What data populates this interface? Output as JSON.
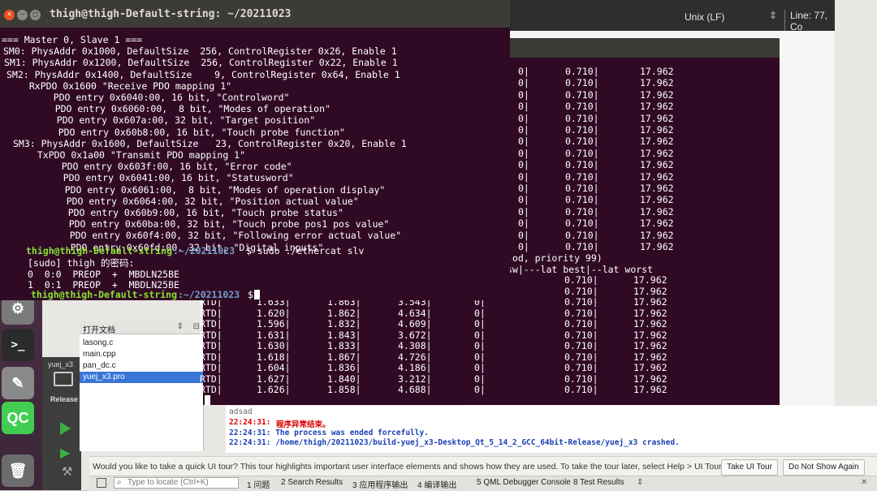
{
  "qtcreator": {
    "encoding": "Unix (LF)",
    "line_info": "Line: 77, Co",
    "kit_label": "yuej_x3",
    "build_config": "Release",
    "open_docs": {
      "title": "打开文档",
      "items": [
        "lasong.c",
        "main.cpp",
        "pan_dc.c",
        "yuej_x3.pro"
      ],
      "selected": 3
    },
    "app_output": {
      "line1": "adsad",
      "line2_time": "22:24:31:",
      "line2_msg": "程序异常结束。",
      "line3": "22:24:31: The process was ended forcefully.",
      "line4": "22:24:31: /home/thigh/20211023/build-yuej_x3-Desktop_Qt_5_14_2_GCC_64bit-Release/yuej_x3 crashed."
    },
    "tour": {
      "text": "Would you like to take a quick UI tour? This tour highlights important user interface elements and shows how they are used. To take the tour later, select Help > UI Tour.",
      "take_label": "Take UI Tour",
      "dismiss_label": "Do Not Show Again"
    },
    "statusbar": {
      "locator_placeholder": "Type to locate (Ctrl+K)",
      "tabs": [
        "1 问题",
        "2 Search Results",
        "3 应用程序输出",
        "4 编译输出",
        "5 QML Debugger Console",
        "8 Test Results"
      ]
    }
  },
  "terminal_back": {
    "top_rows": [
      {
        "a": "0|",
        "b": "0.710|",
        "c": "17.962"
      },
      {
        "a": "0|",
        "b": "0.710|",
        "c": "17.962"
      },
      {
        "a": "0|",
        "b": "0.710|",
        "c": "17.962"
      },
      {
        "a": "0|",
        "b": "0.710|",
        "c": "17.962"
      },
      {
        "a": "0|",
        "b": "0.710|",
        "c": "17.962"
      },
      {
        "a": "0|",
        "b": "0.710|",
        "c": "17.962"
      },
      {
        "a": "0|",
        "b": "0.710|",
        "c": "17.962"
      },
      {
        "a": "0|",
        "b": "0.710|",
        "c": "17.962"
      },
      {
        "a": "0|",
        "b": "0.710|",
        "c": "17.962"
      },
      {
        "a": "0|",
        "b": "0.710|",
        "c": "17.962"
      },
      {
        "a": "0|",
        "b": "0.710|",
        "c": "17.962"
      },
      {
        "a": "0|",
        "b": "0.710|",
        "c": "17.962"
      },
      {
        "a": "0|",
        "b": "0.710|",
        "c": "17.962"
      },
      {
        "a": "0|",
        "b": "0.710|",
        "c": "17.962"
      },
      {
        "a": "0|",
        "b": "0.710|",
        "c": "17.962"
      },
      {
        "a": "0|",
        "b": "0.710|",
        "c": "17.962"
      }
    ],
    "priority_line": ".od, priority 99)",
    "header_line": "sw|---lat best|--lat worst",
    "bottom_rows": [
      {
        "rtd": "",
        "a": "",
        "b": "",
        "c": "",
        "d": "0|",
        "e": "0.710|",
        "f": "17.962"
      },
      {
        "rtd": "",
        "a": "",
        "b": "",
        "c": "",
        "d": "0|",
        "e": "0.710|",
        "f": "17.962"
      },
      {
        "rtd": "RTD|",
        "a": "1.633|",
        "b": "1.863|",
        "c": "3.543|",
        "d": "0|",
        "e": "0.710|",
        "f": "17.962"
      },
      {
        "rtd": "RTD|",
        "a": "1.620|",
        "b": "1.862|",
        "c": "4.634|",
        "d": "0|",
        "e": "0.710|",
        "f": "17.962"
      },
      {
        "rtd": "RTD|",
        "a": "1.596|",
        "b": "1.832|",
        "c": "4.609|",
        "d": "0|",
        "e": "0.710|",
        "f": "17.962"
      },
      {
        "rtd": "RTD|",
        "a": "1.631|",
        "b": "1.843|",
        "c": "3.672|",
        "d": "0|",
        "e": "0.710|",
        "f": "17.962"
      },
      {
        "rtd": "RTD|",
        "a": "1.630|",
        "b": "1.833|",
        "c": "4.308|",
        "d": "0|",
        "e": "0.710|",
        "f": "17.962"
      },
      {
        "rtd": "RTD|",
        "a": "1.618|",
        "b": "1.867|",
        "c": "4.726|",
        "d": "0|",
        "e": "0.710|",
        "f": "17.962"
      },
      {
        "rtd": "RTD|",
        "a": "1.604|",
        "b": "1.836|",
        "c": "4.186|",
        "d": "0|",
        "e": "0.710|",
        "f": "17.962"
      },
      {
        "rtd": "RTD|",
        "a": "1.627|",
        "b": "1.840|",
        "c": "3.212|",
        "d": "0|",
        "e": "0.710|",
        "f": "17.962"
      },
      {
        "rtd": "RTD|",
        "a": "1.626|",
        "b": "1.858|",
        "c": "4.688|",
        "d": "0|",
        "e": "0.710|",
        "f": "17.962"
      }
    ]
  },
  "terminal_front": {
    "title": "thigh@thigh-Default-string: ~/20211023",
    "lines": [
      "=== Master 0, Slave 1 ===",
      "SM0: PhysAddr 0x1000, DefaultSize  256, ControlRegister 0x26, Enable 1",
      "SM1: PhysAddr 0x1200, DefaultSize  256, ControlRegister 0x22, Enable 1",
      "SM2: PhysAddr 0x1400, DefaultSize    9, ControlRegister 0x64, Enable 1",
      "  RxPDO 0x1600 \"Receive PDO mapping 1\"",
      "    PDO entry 0x6040:00, 16 bit, \"Controlword\"",
      "    PDO entry 0x6060:00,  8 bit, \"Modes of operation\"",
      "    PDO entry 0x607a:00, 32 bit, \"Target position\"",
      "    PDO entry 0x60b8:00, 16 bit, \"Touch probe function\"",
      "SM3: PhysAddr 0x1600, DefaultSize   23, ControlRegister 0x20, Enable 1",
      "  TxPDO 0x1a00 \"Transmit PDO mapping 1\"",
      "    PDO entry 0x603f:00, 16 bit, \"Error code\"",
      "    PDO entry 0x6041:00, 16 bit, \"Statusword\"",
      "    PDO entry 0x6061:00,  8 bit, \"Modes of operation display\"",
      "    PDO entry 0x6064:00, 32 bit, \"Position actual value\"",
      "    PDO entry 0x60b9:00, 16 bit, \"Touch probe status\"",
      "    PDO entry 0x60ba:00, 32 bit, \"Touch probe pos1 pos value\"",
      "    PDO entry 0x60f4:00, 32 bit, \"Following error actual value\"",
      "    PDO entry 0x60fd:00, 32 bit, \"Digital inputs\""
    ],
    "prompt1_user": "thigh@thigh-Default-string",
    "prompt1_path": ":~/20211023",
    "prompt1_cmd": "$ sudo ./ethercat slv",
    "sudo_line": "[sudo] thigh 的密码:",
    "slave_rows": [
      "0  0:0  PREOP  +  MBDLN25BE",
      "1  0:1  PREOP  +  MBDLN25BE"
    ],
    "prompt2_user": "thigh@thigh-Default-string",
    "prompt2_path": ":~/20211023",
    "prompt2_cmd": "$"
  }
}
